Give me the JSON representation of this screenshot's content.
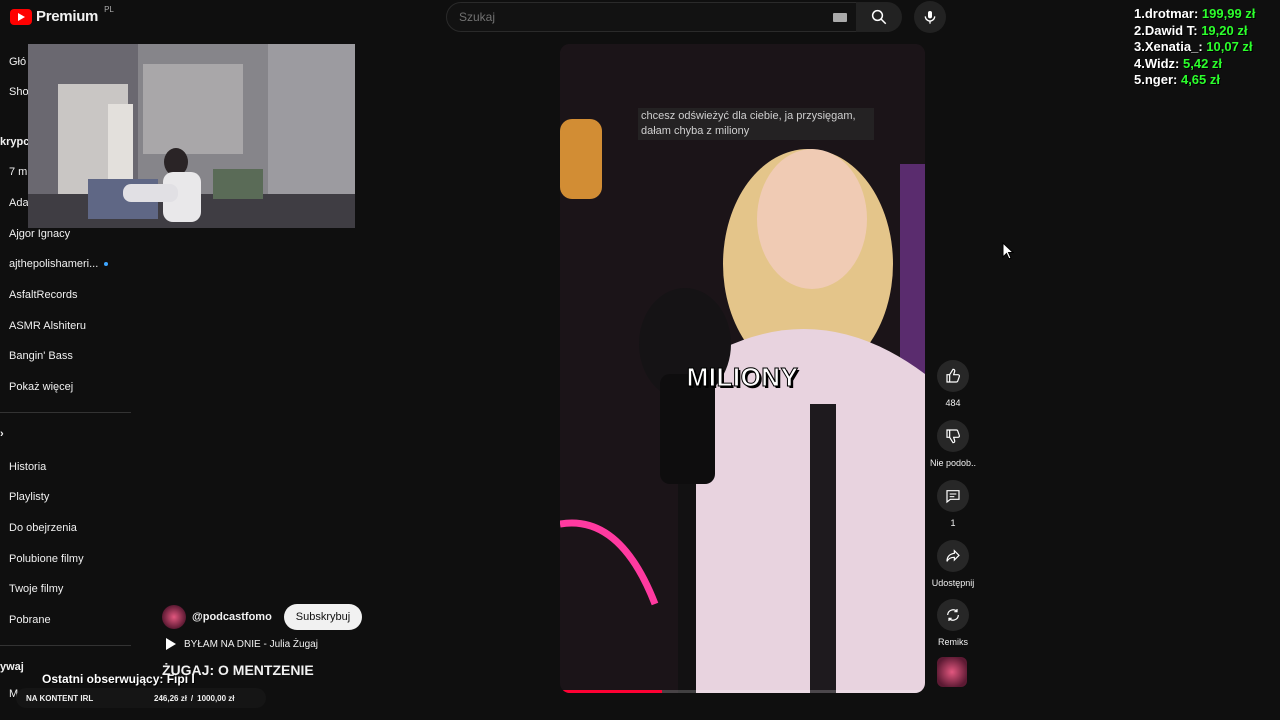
{
  "header": {
    "logo_text": "Premium",
    "logo_region": "PL",
    "search_placeholder": "Szukaj"
  },
  "sidebar": {
    "cut_items": [
      "Głó",
      "Sho",
      "krypc",
      "7 m",
      "Ada"
    ],
    "section_cut": "ywaj",
    "bottom_cut": "Mu",
    "subscriptions": [
      "Ajgor Ignacy",
      "ajthepolishameri...",
      "AsfaltRecords",
      "ASMR Alshiteru",
      "Bangin' Bass",
      "Pokaż więcej"
    ],
    "library": [
      "Historia",
      "Playlisty",
      "Do obejrzenia",
      "Polubione filmy",
      "Twoje filmy",
      "Pobrane"
    ]
  },
  "video": {
    "caption": "chcesz odświeżyć dla ciebie, ja przysięgam, dałam chyba z miliony",
    "big_word": "MILIONY",
    "progress": 0.28
  },
  "actions": {
    "like_count": "484",
    "dislike_label": "Nie podob...",
    "comments_count": "1",
    "share_label": "Udostępnij",
    "remix_label": "Remiks"
  },
  "channel": {
    "handle": "@podcastfomo",
    "subscribe_label": "Subskrybuj",
    "song": "BYŁAM NA DNIE - Julia Żugaj",
    "title": "ŻUGAJ: O MENTZENIE"
  },
  "overlay": {
    "donors": [
      {
        "rank": "1.",
        "name": "drotmar:",
        "amount": "199,99 zł"
      },
      {
        "rank": "2.",
        "name": "Dawid T:",
        "amount": "19,20 zł"
      },
      {
        "rank": "3.",
        "name": "Xenatia_:",
        "amount": "10,07 zł"
      },
      {
        "rank": "4.",
        "name": "Widz:",
        "amount": "5,42 zł"
      },
      {
        "rank": "5.",
        "name": "nger:",
        "amount": "4,65 zł"
      }
    ],
    "last_follower": "Ostatni obserwujący: Fipi I",
    "goal_label": "NA KONTENT IRL",
    "goal_progress": "246,26 zł",
    "goal_sep": "/",
    "goal_target": "1000,00 zł"
  },
  "colors": {
    "accent": "#ff0000",
    "donation": "#2cff2c",
    "progress": "#ff0033"
  }
}
